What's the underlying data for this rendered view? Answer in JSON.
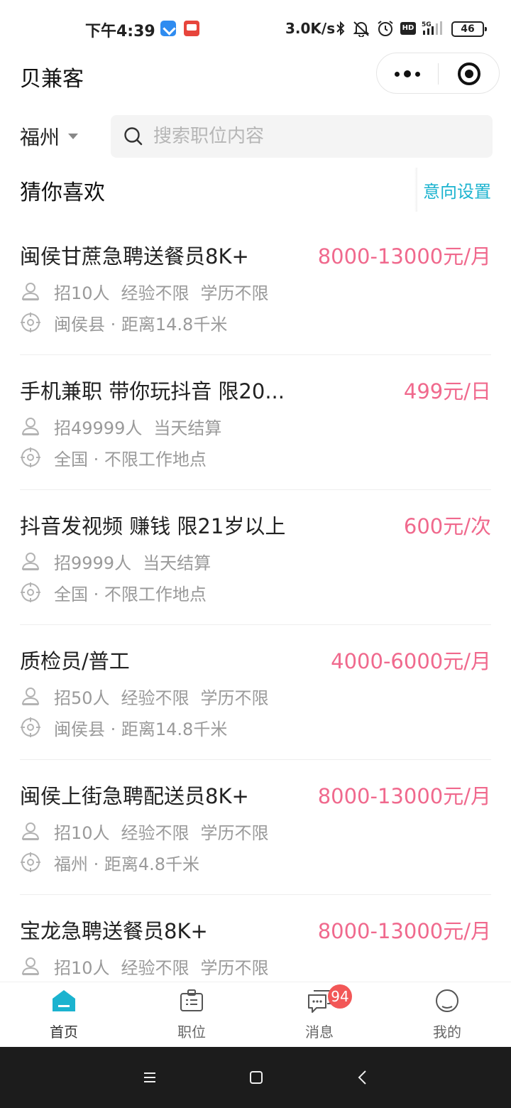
{
  "status_bar": {
    "time": "下午4:39",
    "net_speed": "3.0K/s",
    "hd_label": "HD",
    "network_type": "5G",
    "battery": "46",
    "icons": [
      "app-shield-icon",
      "app-reader-icon",
      "bluetooth-icon",
      "mute-bell-icon",
      "alarm-icon",
      "hd-icon",
      "signal-icon",
      "battery-icon"
    ]
  },
  "header": {
    "title": "贝兼客"
  },
  "filter": {
    "city": "福州",
    "search_placeholder": "搜索职位内容"
  },
  "section": {
    "title": "猜你喜欢",
    "intent_link": "意向设置"
  },
  "jobs": [
    {
      "title": "闽侯甘蔗急聘送餐员8K+",
      "pay": "8000-13000元/月",
      "recruit": "招10人",
      "tags": [
        "经验不限",
        "学历不限"
      ],
      "location": "闽侯县 · 距离14.8千米"
    },
    {
      "title": "手机兼职 带你玩抖音 限20...",
      "pay": "499元/日",
      "recruit": "招49999人",
      "tags": [
        "当天结算"
      ],
      "location": "全国 · 不限工作地点"
    },
    {
      "title": "抖音发视频 赚钱 限21岁以上",
      "pay": "600元/次",
      "recruit": "招9999人",
      "tags": [
        "当天结算"
      ],
      "location": "全国 · 不限工作地点"
    },
    {
      "title": "质检员/普工",
      "pay": "4000-6000元/月",
      "recruit": "招50人",
      "tags": [
        "经验不限",
        "学历不限"
      ],
      "location": "闽侯县 · 距离14.8千米"
    },
    {
      "title": "闽侯上街急聘配送员8K+",
      "pay": "8000-13000元/月",
      "recruit": "招10人",
      "tags": [
        "经验不限",
        "学历不限"
      ],
      "location": "福州 · 距离4.8千米"
    },
    {
      "title": "宝龙急聘送餐员8K+",
      "pay": "8000-13000元/月",
      "recruit": "招10人",
      "tags": [
        "经验不限",
        "学历不限"
      ],
      "location": ""
    }
  ],
  "tabbar": {
    "tabs": [
      {
        "label": "首页",
        "icon": "home-icon",
        "active": true
      },
      {
        "label": "职位",
        "icon": "briefcase-icon",
        "active": false
      },
      {
        "label": "消息",
        "icon": "chat-icon",
        "active": false
      },
      {
        "label": "我的",
        "icon": "profile-icon",
        "active": false
      }
    ],
    "message_badge": "94"
  },
  "colors": {
    "accent": "#1bb3cf",
    "pay": "#f0698d",
    "badge": "#f25757",
    "muted_text": "#9a9a9a"
  }
}
